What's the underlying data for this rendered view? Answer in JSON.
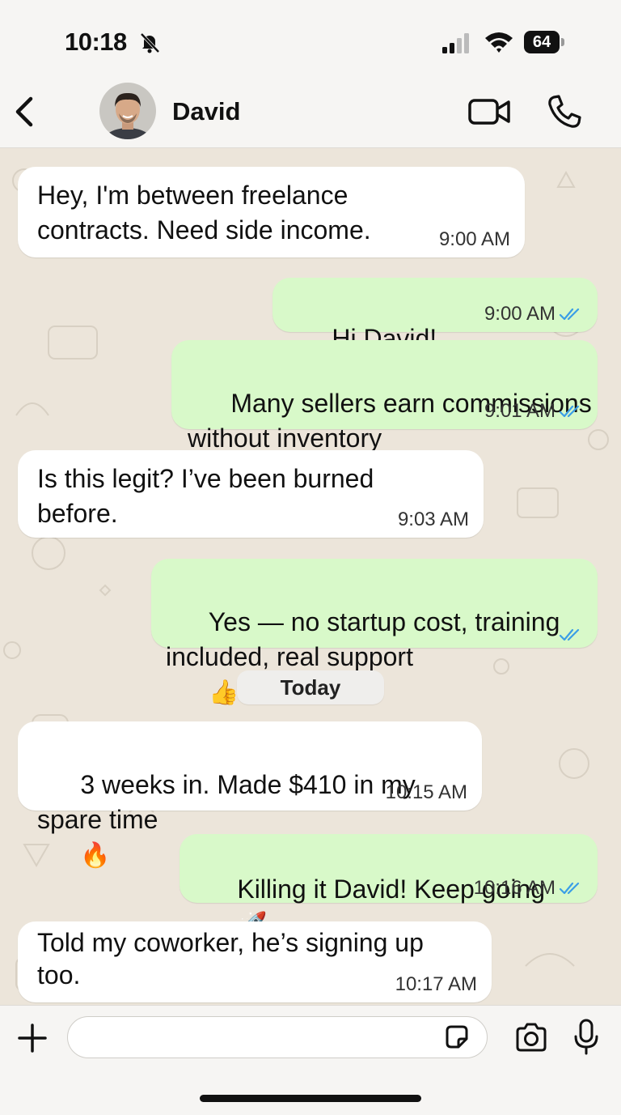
{
  "status_bar": {
    "time": "10:18",
    "battery": "64"
  },
  "header": {
    "contact_name": "David"
  },
  "messages": [
    {
      "direction": "in",
      "text": "Hey, I'm between freelance\ncontracts. Need side income.",
      "time": "9:00 AM"
    },
    {
      "direction": "out",
      "text": "Hi David!",
      "emoji": "👋",
      "time": "9:00 AM",
      "status": "read"
    },
    {
      "direction": "out",
      "text": "Many sellers earn commissions\nwithout inventory",
      "emoji": "💰",
      "time": "9:01 AM",
      "status": "read"
    },
    {
      "direction": "in",
      "text": "Is this legit? I’ve been burned\nbefore.",
      "time": "9:03 AM"
    },
    {
      "direction": "out",
      "text": "Yes — no startup cost, training\nincluded, real support",
      "emoji": "👍",
      "time": "",
      "status": "read"
    },
    {
      "direction": "in",
      "text": "3 weeks in. Made $410 in my\nspare time",
      "emoji": "🔥",
      "time": "10:15 AM"
    },
    {
      "direction": "out",
      "text": "Killing it David! Keep going",
      "emoji": "🚀",
      "time": "10:16 AM",
      "status": "read"
    },
    {
      "direction": "in",
      "text": "Told my coworker, he’s signing up\ntoo.",
      "time": "10:17 AM"
    }
  ],
  "date_divider": "Today",
  "composer": {
    "placeholder": ""
  },
  "colors": {
    "incoming": "#ffffff",
    "outgoing": "#d8f9c9",
    "read_tick": "#3b9ee6",
    "wallpaper": "#ece5da"
  },
  "icons": [
    "bell-slash-icon",
    "signal-icon",
    "wifi-icon",
    "battery-icon",
    "back-chevron-icon",
    "video-call-icon",
    "phone-call-icon",
    "plus-icon",
    "sticker-icon",
    "camera-icon",
    "microphone-icon",
    "double-check-icon"
  ]
}
